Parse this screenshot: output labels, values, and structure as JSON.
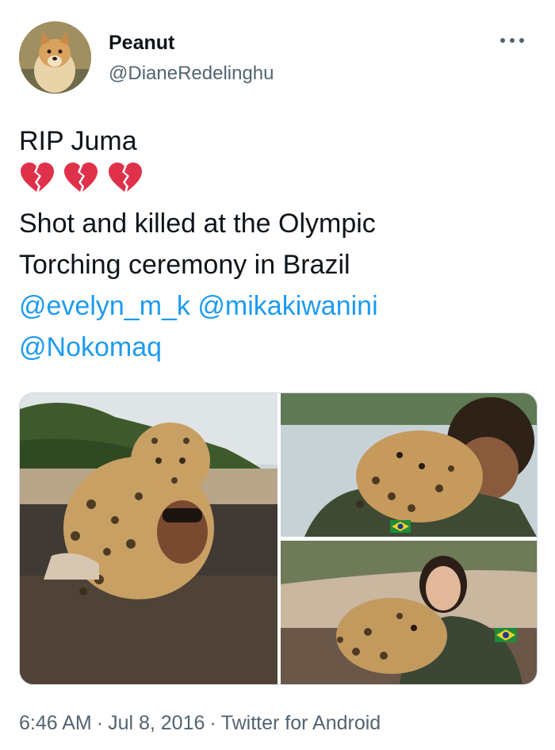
{
  "author": {
    "display_name": "Peanut",
    "handle": "@DianeRedelinghu",
    "avatar_icon": "dog-avatar"
  },
  "tweet": {
    "text_line_1": "RIP Juma",
    "emoji": [
      "broken-heart-icon",
      "broken-heart-icon",
      "broken-heart-icon"
    ],
    "text_line_2": "Shot and killed at the Olympic",
    "text_line_3": "Torching ceremony in Brazil",
    "mentions": [
      "@evelyn_m_k",
      "@mikakiwanini",
      "@Nokomaq"
    ]
  },
  "media": {
    "count": 3,
    "photos": [
      "jaguar-on-man-in-river",
      "jaguar-hugging-soldier",
      "jaguar-with-woman-soldier"
    ]
  },
  "meta": {
    "time": "6:46 AM",
    "separator": "·",
    "date": "Jul 8, 2016",
    "source": "Twitter for Android"
  },
  "colors": {
    "text": "#0f1419",
    "secondary": "#536471",
    "link": "#1d9bf0",
    "heart": "#e0314b"
  }
}
